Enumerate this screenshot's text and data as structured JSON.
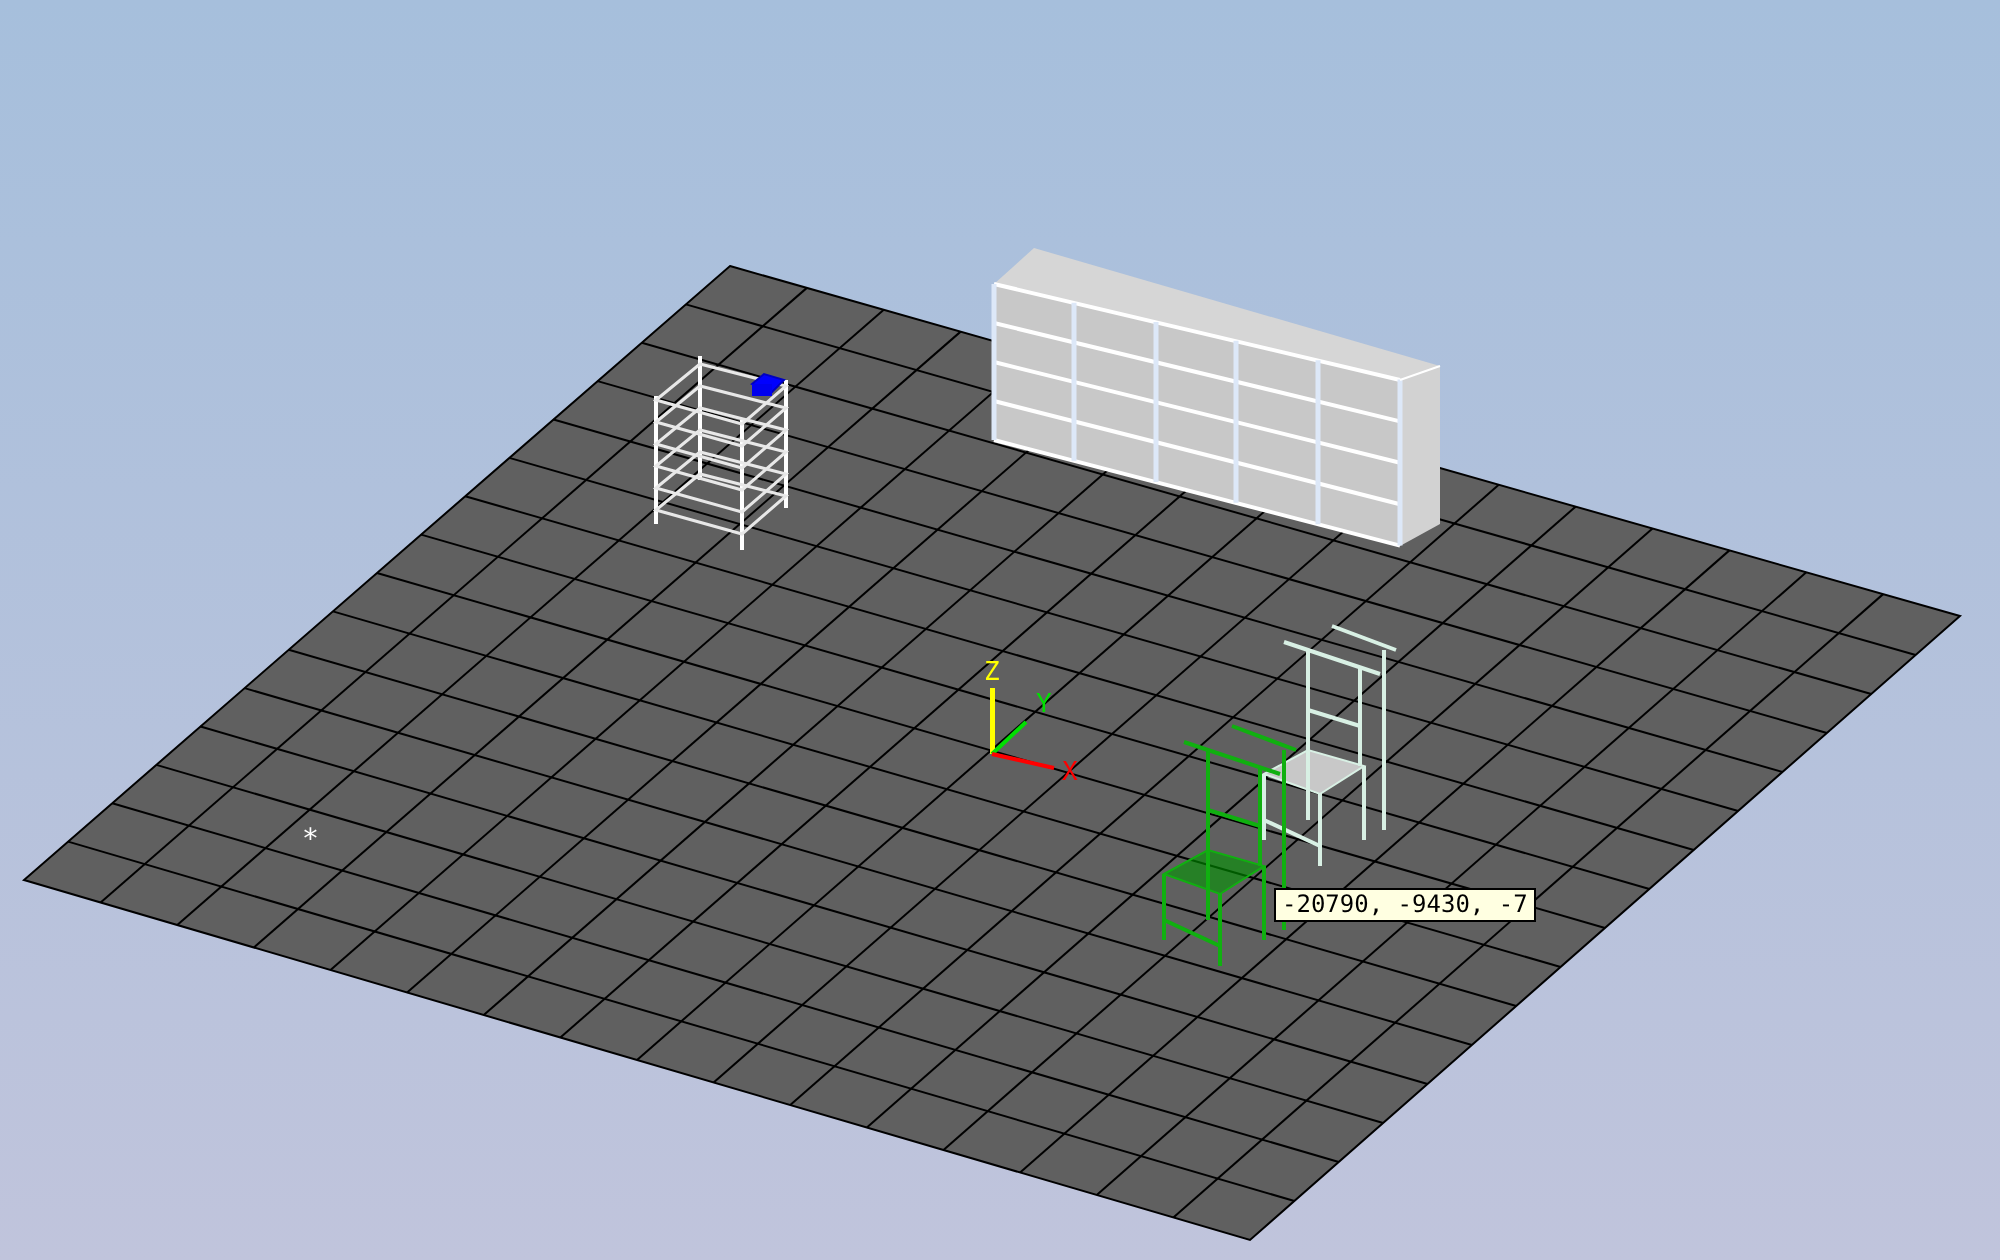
{
  "viewport": {
    "axes": [
      {
        "label": "Z",
        "color": "#ffff00"
      },
      {
        "label": "Y",
        "color": "#00e000"
      },
      {
        "label": "X",
        "color": "#ff0000"
      }
    ],
    "cursor_marker": "*",
    "tooltip": "-20790, -9430, -7"
  }
}
